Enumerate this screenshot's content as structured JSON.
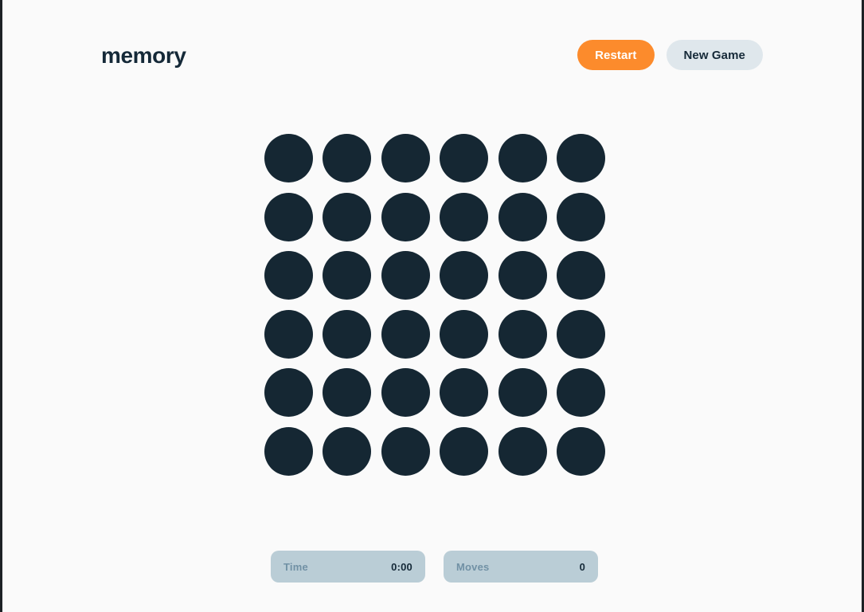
{
  "header": {
    "title": "memory",
    "buttons": [
      {
        "label": "Restart",
        "name": "restart-button",
        "style": "primary"
      },
      {
        "label": "New Game",
        "name": "new-game-button",
        "style": "secondary"
      }
    ]
  },
  "board": {
    "rows": 6,
    "columns": 6,
    "total_cards": 36,
    "cards": [
      {
        "state": "face-down"
      },
      {
        "state": "face-down"
      },
      {
        "state": "face-down"
      },
      {
        "state": "face-down"
      },
      {
        "state": "face-down"
      },
      {
        "state": "face-down"
      },
      {
        "state": "face-down"
      },
      {
        "state": "face-down"
      },
      {
        "state": "face-down"
      },
      {
        "state": "face-down"
      },
      {
        "state": "face-down"
      },
      {
        "state": "face-down"
      },
      {
        "state": "face-down"
      },
      {
        "state": "face-down"
      },
      {
        "state": "face-down"
      },
      {
        "state": "face-down"
      },
      {
        "state": "face-down"
      },
      {
        "state": "face-down"
      },
      {
        "state": "face-down"
      },
      {
        "state": "face-down"
      },
      {
        "state": "face-down"
      },
      {
        "state": "face-down"
      },
      {
        "state": "face-down"
      },
      {
        "state": "face-down"
      },
      {
        "state": "face-down"
      },
      {
        "state": "face-down"
      },
      {
        "state": "face-down"
      },
      {
        "state": "face-down"
      },
      {
        "state": "face-down"
      },
      {
        "state": "face-down"
      },
      {
        "state": "face-down"
      },
      {
        "state": "face-down"
      },
      {
        "state": "face-down"
      },
      {
        "state": "face-down"
      },
      {
        "state": "face-down"
      },
      {
        "state": "face-down"
      }
    ]
  },
  "stats": {
    "time": {
      "label": "Time",
      "value": "0:00"
    },
    "moves": {
      "label": "Moves",
      "value": "0"
    }
  },
  "colors": {
    "background": "#fafafa",
    "card_back": "#152733",
    "accent_orange": "#fc8b2c",
    "secondary_button": "#dfe7ec",
    "stat_panel": "#bacdd6",
    "stat_label_text": "#7191a5",
    "dark_text": "#152938",
    "frame_edge": "#1d2125"
  }
}
